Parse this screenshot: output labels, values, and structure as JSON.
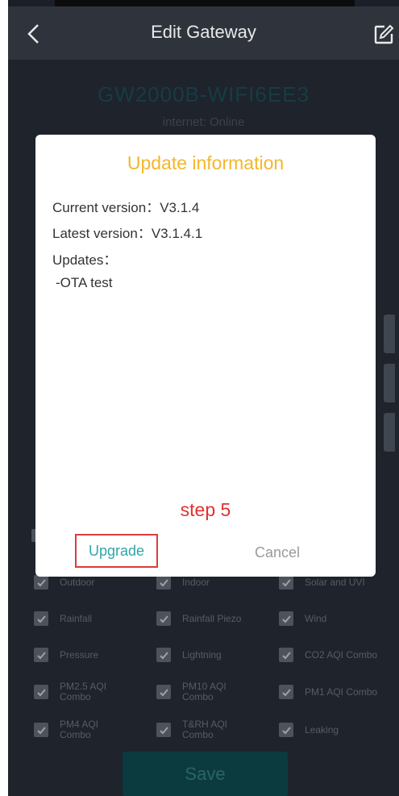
{
  "header": {
    "title": "Edit Gateway"
  },
  "gateway": {
    "name": "GW2000B-WIFI6EE3",
    "status": "internet: Online"
  },
  "dialog": {
    "title": "Update information",
    "current_version": "Current version：V3.1.4",
    "latest_version": "Latest version：V3.1.4.1",
    "updates_label": "Updates：",
    "update_item": "-OTA test",
    "annotation": "step 5",
    "upgrade_label": "Upgrade",
    "cancel_label": "Cancel"
  },
  "sensors": [
    {
      "label": "Outdoor",
      "checked": true
    },
    {
      "label": "Indoor",
      "checked": true
    },
    {
      "label": "Solar and UVI",
      "checked": true
    },
    {
      "label": "Rainfall",
      "checked": true
    },
    {
      "label": "Rainfall Piezo",
      "checked": true
    },
    {
      "label": "Wind",
      "checked": true
    },
    {
      "label": "Pressure",
      "checked": true
    },
    {
      "label": "Lightning",
      "checked": true
    },
    {
      "label": "CO2 AQI Combo",
      "checked": true
    },
    {
      "label": "PM2.5 AQI Combo",
      "checked": true
    },
    {
      "label": "PM10 AQI Combo",
      "checked": true
    },
    {
      "label": "PM1 AQI Combo",
      "checked": true
    },
    {
      "label": "PM4 AQI Combo",
      "checked": true
    },
    {
      "label": "T&RH AQI Combo",
      "checked": true
    },
    {
      "label": "Leaking",
      "checked": true
    }
  ],
  "save_label": "Save",
  "icons": {
    "back": "chevron-left-icon",
    "edit": "edit-icon",
    "checkbox": "checkmark-icon"
  },
  "colors": {
    "accent": "#2fa7a7",
    "dialog_title": "#f3b62d",
    "annotation": "#e1312f"
  }
}
